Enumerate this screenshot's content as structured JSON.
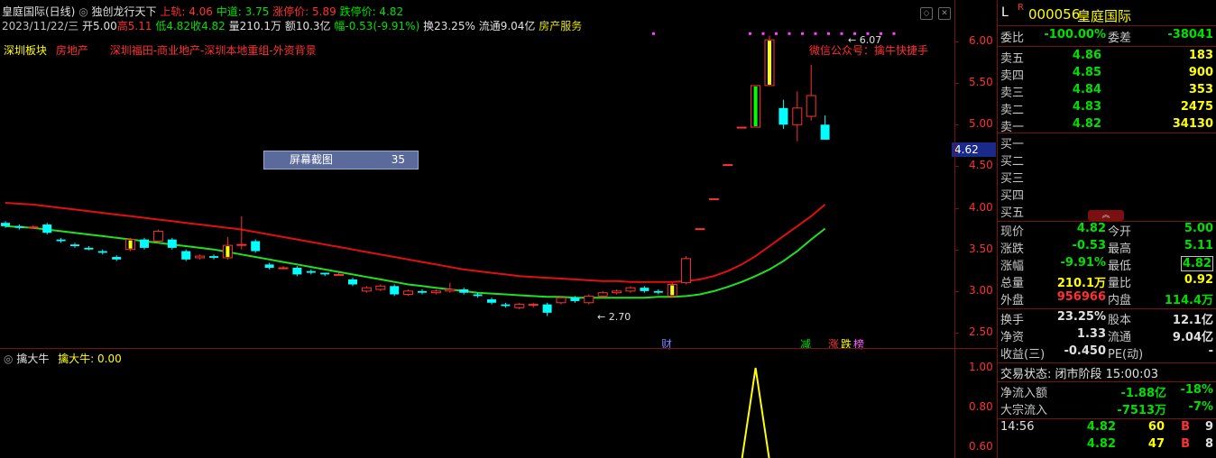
{
  "header": {
    "title": "皇庭国际(日线)",
    "strategy": "独创龙行天下",
    "upper_label": "上轨: 4.06",
    "mid_label": "中道: 3.75",
    "limit_up_label": "涨停价: 5.89",
    "limit_down_label": "跌停价: 4.82",
    "bar_date": "2023/11/22/三",
    "bar_open": "开5.00",
    "bar_high": "高5.11",
    "bar_low": "低4.82",
    "bar_close": "收4.82",
    "bar_vol": "量210.1万",
    "bar_amount": "额10.3亿",
    "bar_range": "幅-0.53(-9.91%)",
    "bar_turnover": "换23.25%",
    "bar_float": "流通9.04亿",
    "bar_sector": "房产服务"
  },
  "tags": {
    "t1": "深圳板块",
    "t2": "房地产",
    "t3": "深圳福田-商业地产-深圳本地重组-外资背景",
    "wechat": "微信公众号：擒牛快捷手",
    "high_mark": "6.07",
    "low_mark": "2.70"
  },
  "overlay": {
    "label": "屏幕截图",
    "value": "35"
  },
  "price_label": "4.62",
  "y_ticks": [
    "6.00",
    "5.50",
    "5.00",
    "4.50",
    "4.00",
    "3.50",
    "3.00",
    "2.50"
  ],
  "markers": {
    "m1": "财",
    "m2": "减",
    "m3": "涨",
    "m4": "跌",
    "m5": "榜"
  },
  "indicator": {
    "name": "擒大牛",
    "value_label": "擒大牛: 0.00",
    "ticks": [
      "1.00",
      "0.80",
      "0.60"
    ]
  },
  "chart_data": {
    "type": "candlestick",
    "ylim": [
      2.3,
      6.3
    ],
    "candles": [
      [
        3.82,
        3.78,
        3.84,
        3.76
      ],
      [
        3.78,
        3.76,
        3.8,
        3.74
      ],
      [
        3.77,
        3.77,
        3.79,
        3.75
      ],
      [
        3.8,
        3.7,
        3.82,
        3.68
      ],
      [
        3.62,
        3.6,
        3.64,
        3.58
      ],
      [
        3.56,
        3.54,
        3.58,
        3.52
      ],
      [
        3.52,
        3.5,
        3.54,
        3.49
      ],
      [
        3.48,
        3.46,
        3.5,
        3.44
      ],
      [
        3.41,
        3.38,
        3.43,
        3.36
      ],
      [
        3.5,
        3.62,
        3.64,
        3.48
      ],
      [
        3.62,
        3.52,
        3.64,
        3.5
      ],
      [
        3.6,
        3.72,
        3.74,
        3.58
      ],
      [
        3.62,
        3.52,
        3.64,
        3.5
      ],
      [
        3.48,
        3.38,
        3.5,
        3.36
      ],
      [
        3.4,
        3.42,
        3.44,
        3.38
      ],
      [
        3.42,
        3.4,
        3.44,
        3.38
      ],
      [
        3.4,
        3.55,
        3.65,
        3.38
      ],
      [
        3.55,
        3.56,
        3.9,
        3.5
      ],
      [
        3.6,
        3.48,
        3.62,
        3.46
      ],
      [
        3.32,
        3.28,
        3.34,
        3.26
      ],
      [
        3.28,
        3.28,
        3.3,
        3.26
      ],
      [
        3.28,
        3.2,
        3.3,
        3.18
      ],
      [
        3.24,
        3.22,
        3.26,
        3.2
      ],
      [
        3.22,
        3.2,
        3.22,
        3.18
      ],
      [
        3.2,
        3.2,
        3.22,
        3.18
      ],
      [
        3.14,
        3.08,
        3.16,
        3.06
      ],
      [
        3.0,
        3.04,
        3.06,
        2.98
      ],
      [
        3.02,
        3.06,
        3.08,
        3.0
      ],
      [
        3.06,
        2.96,
        3.08,
        2.94
      ],
      [
        2.96,
        3.0,
        3.02,
        2.94
      ],
      [
        3.0,
        2.98,
        3.02,
        2.96
      ],
      [
        2.98,
        3.0,
        3.02,
        2.96
      ],
      [
        3.0,
        3.02,
        3.1,
        2.98
      ],
      [
        3.02,
        2.98,
        3.04,
        2.96
      ],
      [
        2.96,
        2.94,
        2.98,
        2.92
      ],
      [
        2.9,
        2.86,
        2.92,
        2.84
      ],
      [
        2.84,
        2.82,
        2.86,
        2.8
      ],
      [
        2.8,
        2.84,
        2.86,
        2.78
      ],
      [
        2.84,
        2.84,
        2.86,
        2.8
      ],
      [
        2.84,
        2.74,
        2.86,
        2.7
      ],
      [
        2.86,
        2.92,
        2.94,
        2.84
      ],
      [
        2.92,
        2.88,
        2.94,
        2.86
      ],
      [
        2.86,
        2.94,
        2.96,
        2.84
      ],
      [
        2.94,
        2.98,
        3.0,
        2.92
      ],
      [
        2.98,
        3.0,
        3.02,
        2.96
      ],
      [
        3.0,
        3.04,
        3.06,
        2.98
      ],
      [
        3.04,
        3.0,
        3.06,
        2.98
      ],
      [
        3.0,
        2.98,
        3.02,
        2.96
      ],
      [
        2.94,
        3.08,
        3.1,
        2.92
      ],
      [
        3.1,
        3.39,
        3.42,
        3.08
      ],
      [
        3.75,
        3.75,
        3.75,
        3.75
      ],
      [
        4.11,
        4.11,
        4.11,
        4.11
      ],
      [
        4.52,
        4.52,
        4.52,
        4.52
      ],
      [
        4.97,
        4.97,
        4.97,
        4.97
      ],
      [
        4.97,
        5.47,
        5.47,
        4.97
      ],
      [
        5.47,
        6.02,
        6.07,
        5.47
      ],
      [
        5.2,
        5.0,
        5.3,
        4.95
      ],
      [
        5.0,
        5.2,
        5.4,
        4.8
      ],
      [
        5.1,
        5.35,
        5.72,
        5.05
      ],
      [
        5.0,
        4.82,
        5.11,
        4.82
      ]
    ],
    "upper_band": [
      4.06,
      4.05,
      4.04,
      4.02,
      4.0,
      3.98,
      3.96,
      3.94,
      3.92,
      3.9,
      3.88,
      3.86,
      3.84,
      3.82,
      3.8,
      3.78,
      3.76,
      3.74,
      3.71,
      3.68,
      3.65,
      3.62,
      3.59,
      3.56,
      3.53,
      3.5,
      3.47,
      3.44,
      3.41,
      3.38,
      3.35,
      3.32,
      3.29,
      3.26,
      3.24,
      3.22,
      3.2,
      3.18,
      3.17,
      3.16,
      3.15,
      3.14,
      3.13,
      3.12,
      3.12,
      3.11,
      3.11,
      3.11,
      3.11,
      3.12,
      3.14,
      3.18,
      3.24,
      3.32,
      3.42,
      3.54,
      3.66,
      3.78,
      3.9,
      4.04
    ],
    "mid_band": [
      3.78,
      3.77,
      3.76,
      3.74,
      3.72,
      3.7,
      3.68,
      3.66,
      3.64,
      3.62,
      3.6,
      3.58,
      3.56,
      3.54,
      3.52,
      3.5,
      3.47,
      3.44,
      3.41,
      3.38,
      3.35,
      3.32,
      3.29,
      3.26,
      3.23,
      3.2,
      3.17,
      3.14,
      3.11,
      3.08,
      3.06,
      3.04,
      3.02,
      3.0,
      2.98,
      2.97,
      2.96,
      2.95,
      2.94,
      2.93,
      2.93,
      2.92,
      2.92,
      2.92,
      2.92,
      2.92,
      2.92,
      2.93,
      2.93,
      2.94,
      2.96,
      3.0,
      3.05,
      3.11,
      3.18,
      3.26,
      3.36,
      3.48,
      3.62,
      3.75
    ],
    "dots_y": 6.1,
    "indicator_values": [
      0,
      0,
      0,
      0,
      0,
      0,
      0,
      0,
      0,
      0,
      0,
      0,
      0,
      0,
      0,
      0,
      0,
      0,
      0,
      0,
      0,
      0,
      0,
      0,
      0,
      0,
      0,
      0,
      0,
      0,
      0,
      0,
      0,
      0,
      0,
      0,
      0,
      0,
      0,
      0,
      0,
      0,
      0,
      0,
      0,
      0,
      0,
      0,
      0,
      0,
      0,
      0,
      0,
      0,
      1,
      0,
      0,
      0,
      0,
      0
    ]
  },
  "quote": {
    "code": "000056",
    "name": "皇庭国际",
    "wb_label": "委比",
    "wb_value": "-100.00%",
    "wc_label": "委差",
    "wc_value": "-38041",
    "sells": [
      {
        "label": "卖五",
        "price": "4.86",
        "vol": "183"
      },
      {
        "label": "卖四",
        "price": "4.85",
        "vol": "900"
      },
      {
        "label": "卖三",
        "price": "4.84",
        "vol": "353"
      },
      {
        "label": "卖二",
        "price": "4.83",
        "vol": "2475"
      },
      {
        "label": "卖一",
        "price": "4.82",
        "vol": "34130"
      }
    ],
    "buys": [
      {
        "label": "买一"
      },
      {
        "label": "买二"
      },
      {
        "label": "买三"
      },
      {
        "label": "买四"
      },
      {
        "label": "买五"
      }
    ],
    "stats": [
      {
        "l": "现价",
        "v": "4.82",
        "vc": "g",
        "l2": "今开",
        "v2": "5.00",
        "v2c": "g"
      },
      {
        "l": "涨跌",
        "v": "-0.53",
        "vc": "g",
        "l2": "最高",
        "v2": "5.11",
        "v2c": "g"
      },
      {
        "l": "涨幅",
        "v": "-9.91%",
        "vc": "g",
        "l2": "最低",
        "v2": "4.82",
        "v2c": "g"
      },
      {
        "l": "总量",
        "v": "210.1万",
        "vc": "y",
        "l2": "量比",
        "v2": "0.92",
        "v2c": "y"
      },
      {
        "l": "外盘",
        "v": "956966",
        "vc": "r",
        "l2": "内盘",
        "v2": "114.4万",
        "v2c": "g"
      }
    ],
    "stats2": [
      {
        "l": "换手",
        "v": "23.25%",
        "vc": "w",
        "l2": "股本",
        "v2": "12.1亿",
        "v2c": "w"
      },
      {
        "l": "净资",
        "v": "1.33",
        "vc": "w",
        "l2": "流通",
        "v2": "9.04亿",
        "v2c": "w"
      },
      {
        "l": "收益(三)",
        "v": "-0.450",
        "vc": "w",
        "l2": "PE(动)",
        "v2": "-",
        "v2c": "w"
      }
    ],
    "trade_state": "交易状态: 闭市阶段 15:00:03",
    "net_inflow_label": "净流入额",
    "net_inflow": "-1.88亿",
    "net_inflow_pct": "-18%",
    "block_label": "大宗流入",
    "block": "-7513万",
    "block_pct": "-7%",
    "ticks": [
      {
        "t": "14:56",
        "p": "4.82",
        "v": "60",
        "s": "B",
        "n": "9"
      },
      {
        "t": "",
        "p": "4.82",
        "v": "47",
        "s": "B",
        "n": "8"
      }
    ]
  }
}
